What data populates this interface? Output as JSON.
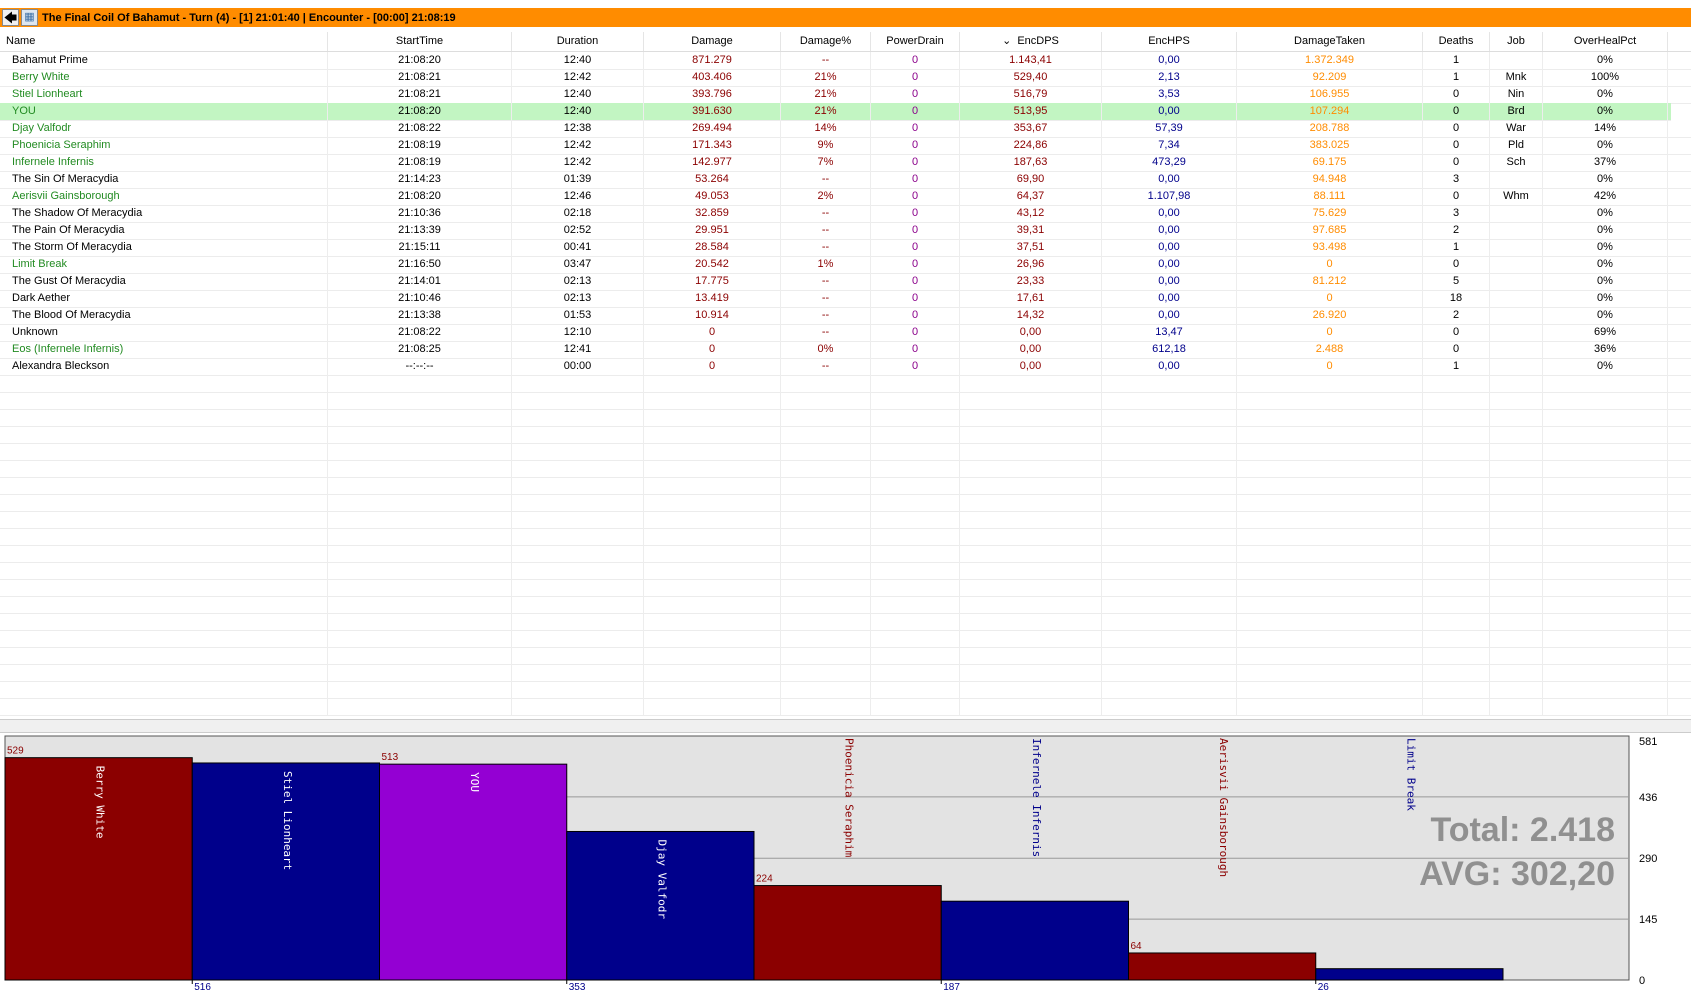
{
  "titlebar": {
    "back_icon": "back-arrow-icon",
    "image_icon": "picture-icon",
    "title": "The Final Coil Of Bahamut - Turn (4) - [1] 21:01:40  |  Encounter - [00:00] 21:08:19"
  },
  "table": {
    "columns": [
      "Name",
      "StartTime",
      "Duration",
      "Damage",
      "Damage%",
      "PowerDrain",
      "EncDPS",
      "EncHPS",
      "DamageTaken",
      "Deaths",
      "Job",
      "OverHealPct"
    ],
    "sort_indicator": "⌄",
    "rows": [
      {
        "name": "Bahamut Prime",
        "start": "21:08:20",
        "dur": "12:40",
        "dmg": "871.279",
        "pct": "--",
        "pd": "0",
        "dps": "1.143,41",
        "hps": "0,00",
        "taken": "1.372.349",
        "deaths": "1",
        "job": "",
        "oh": "0%",
        "green": false
      },
      {
        "name": "Berry White",
        "start": "21:08:21",
        "dur": "12:42",
        "dmg": "403.406",
        "pct": "21%",
        "pd": "0",
        "dps": "529,40",
        "hps": "2,13",
        "taken": "92.209",
        "deaths": "1",
        "job": "Mnk",
        "oh": "100%",
        "green": true
      },
      {
        "name": "Stiel Lionheart",
        "start": "21:08:21",
        "dur": "12:40",
        "dmg": "393.796",
        "pct": "21%",
        "pd": "0",
        "dps": "516,79",
        "hps": "3,53",
        "taken": "106.955",
        "deaths": "0",
        "job": "Nin",
        "oh": "0%",
        "green": true
      },
      {
        "name": "YOU",
        "start": "21:08:20",
        "dur": "12:40",
        "dmg": "391.630",
        "pct": "21%",
        "pd": "0",
        "dps": "513,95",
        "hps": "0,00",
        "taken": "107.294",
        "deaths": "0",
        "job": "Brd",
        "oh": "0%",
        "green": true,
        "highlight": true
      },
      {
        "name": "Djay Valfodr",
        "start": "21:08:22",
        "dur": "12:38",
        "dmg": "269.494",
        "pct": "14%",
        "pd": "0",
        "dps": "353,67",
        "hps": "57,39",
        "taken": "208.788",
        "deaths": "0",
        "job": "War",
        "oh": "14%",
        "green": true
      },
      {
        "name": "Phoenicia Seraphim",
        "start": "21:08:19",
        "dur": "12:42",
        "dmg": "171.343",
        "pct": "9%",
        "pd": "0",
        "dps": "224,86",
        "hps": "7,34",
        "taken": "383.025",
        "deaths": "0",
        "job": "Pld",
        "oh": "0%",
        "green": true
      },
      {
        "name": "Infernele Infernis",
        "start": "21:08:19",
        "dur": "12:42",
        "dmg": "142.977",
        "pct": "7%",
        "pd": "0",
        "dps": "187,63",
        "hps": "473,29",
        "taken": "69.175",
        "deaths": "0",
        "job": "Sch",
        "oh": "37%",
        "green": true
      },
      {
        "name": "The Sin Of Meracydia",
        "start": "21:14:23",
        "dur": "01:39",
        "dmg": "53.264",
        "pct": "--",
        "pd": "0",
        "dps": "69,90",
        "hps": "0,00",
        "taken": "94.948",
        "deaths": "3",
        "job": "",
        "oh": "0%",
        "green": false
      },
      {
        "name": "Aerisvii Gainsborough",
        "start": "21:08:20",
        "dur": "12:46",
        "dmg": "49.053",
        "pct": "2%",
        "pd": "0",
        "dps": "64,37",
        "hps": "1.107,98",
        "taken": "88.111",
        "deaths": "0",
        "job": "Whm",
        "oh": "42%",
        "green": true
      },
      {
        "name": "The Shadow Of Meracydia",
        "start": "21:10:36",
        "dur": "02:18",
        "dmg": "32.859",
        "pct": "--",
        "pd": "0",
        "dps": "43,12",
        "hps": "0,00",
        "taken": "75.629",
        "deaths": "3",
        "job": "",
        "oh": "0%",
        "green": false
      },
      {
        "name": "The Pain Of Meracydia",
        "start": "21:13:39",
        "dur": "02:52",
        "dmg": "29.951",
        "pct": "--",
        "pd": "0",
        "dps": "39,31",
        "hps": "0,00",
        "taken": "97.685",
        "deaths": "2",
        "job": "",
        "oh": "0%",
        "green": false
      },
      {
        "name": "The Storm Of Meracydia",
        "start": "21:15:11",
        "dur": "00:41",
        "dmg": "28.584",
        "pct": "--",
        "pd": "0",
        "dps": "37,51",
        "hps": "0,00",
        "taken": "93.498",
        "deaths": "1",
        "job": "",
        "oh": "0%",
        "green": false
      },
      {
        "name": "Limit Break",
        "start": "21:16:50",
        "dur": "03:47",
        "dmg": "20.542",
        "pct": "1%",
        "pd": "0",
        "dps": "26,96",
        "hps": "0,00",
        "taken": "0",
        "deaths": "0",
        "job": "",
        "oh": "0%",
        "green": true
      },
      {
        "name": "The Gust Of Meracydia",
        "start": "21:14:01",
        "dur": "02:13",
        "dmg": "17.775",
        "pct": "--",
        "pd": "0",
        "dps": "23,33",
        "hps": "0,00",
        "taken": "81.212",
        "deaths": "5",
        "job": "",
        "oh": "0%",
        "green": false
      },
      {
        "name": "Dark Aether",
        "start": "21:10:46",
        "dur": "02:13",
        "dmg": "13.419",
        "pct": "--",
        "pd": "0",
        "dps": "17,61",
        "hps": "0,00",
        "taken": "0",
        "deaths": "18",
        "job": "",
        "oh": "0%",
        "green": false
      },
      {
        "name": "The Blood Of Meracydia",
        "start": "21:13:38",
        "dur": "01:53",
        "dmg": "10.914",
        "pct": "--",
        "pd": "0",
        "dps": "14,32",
        "hps": "0,00",
        "taken": "26.920",
        "deaths": "2",
        "job": "",
        "oh": "0%",
        "green": false
      },
      {
        "name": "Unknown",
        "start": "21:08:22",
        "dur": "12:10",
        "dmg": "0",
        "pct": "--",
        "pd": "0",
        "dps": "0,00",
        "hps": "13,47",
        "taken": "0",
        "deaths": "0",
        "job": "",
        "oh": "69%",
        "green": false
      },
      {
        "name": "Eos (Infernele Infernis)",
        "start": "21:08:25",
        "dur": "12:41",
        "dmg": "0",
        "pct": "0%",
        "pd": "0",
        "dps": "0,00",
        "hps": "612,18",
        "taken": "2.488",
        "deaths": "0",
        "job": "",
        "oh": "36%",
        "green": true
      },
      {
        "name": "Alexandra Bleckson",
        "start": "--:--:--",
        "dur": "00:00",
        "dmg": "0",
        "pct": "--",
        "pd": "0",
        "dps": "0,00",
        "hps": "0,00",
        "taken": "0",
        "deaths": "1",
        "job": "",
        "oh": "0%",
        "green": false
      }
    ]
  },
  "colors": {
    "titlebar": "#ff8c00",
    "highlight_row": "#c2f5c2",
    "damage": "#8b0000",
    "powerdrain": "#8b008b",
    "heal": "#00008b",
    "taken": "#ff8c00",
    "ally": "#228b22",
    "bar_red": "#8b0000",
    "bar_blue": "#00008b",
    "bar_purple": "#9400d3"
  },
  "chart_data": {
    "type": "bar",
    "categories": [
      "Berry White",
      "Stiel Lionheart",
      "YOU",
      "Djay Valfodr",
      "Phoenicia Seraphim",
      "Infernele Infernis",
      "Aerisvii Gainsborough",
      "Limit Break"
    ],
    "values": [
      529.4,
      516.79,
      513.95,
      353.67,
      224.86,
      187.63,
      64.37,
      26.96
    ],
    "top_labels": [
      "529",
      "",
      "513",
      "",
      "224",
      "",
      "64",
      ""
    ],
    "bottom_labels": [
      "",
      "516",
      "",
      "353",
      "",
      "187",
      "",
      "26"
    ],
    "bar_colors": [
      "#8b0000",
      "#00008b",
      "#9400d3",
      "#00008b",
      "#8b0000",
      "#00008b",
      "#8b0000",
      "#00008b"
    ],
    "name_positions": [
      "inside",
      "inside",
      "inside",
      "inside",
      "above",
      "above",
      "above",
      "above"
    ],
    "ylim": [
      0,
      581
    ],
    "yticks": [
      0,
      145,
      290,
      436,
      581
    ],
    "total_text": "Total: 2.418",
    "avg_text": "AVG: 302,20"
  }
}
